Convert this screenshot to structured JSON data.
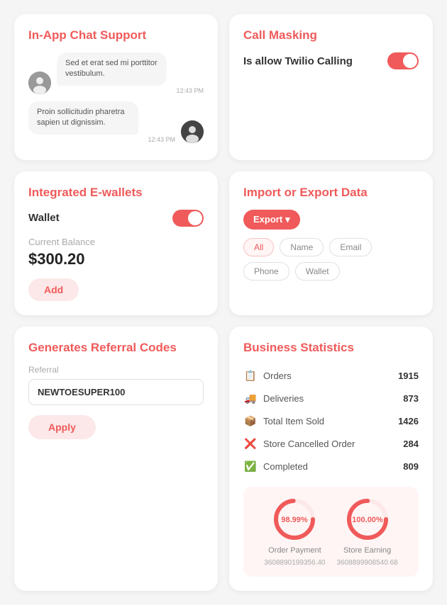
{
  "chat": {
    "title": "In-App Chat Support",
    "messages": [
      {
        "side": "left",
        "text": "Sed et erat sed mi porttitor vestibulum.",
        "time": "12:43 PM"
      },
      {
        "side": "right",
        "text": "Proin sollicitudin pharetra sapien ut dignissim.",
        "time": "12:43 PM"
      }
    ]
  },
  "call_masking": {
    "title": "Call Masking",
    "label": "Is allow Twilio Calling",
    "enabled": true
  },
  "import_export": {
    "title": "Import or Export Data",
    "export_label": "Export",
    "filters": [
      "All",
      "Name",
      "Email",
      "Phone",
      "Wallet"
    ],
    "active_filter": "All"
  },
  "ewallets": {
    "title": "Integrated E-wallets",
    "wallet_label": "Wallet",
    "wallet_enabled": true,
    "balance_label": "Current Balance",
    "balance": "$300.20",
    "add_label": "Add"
  },
  "referral": {
    "title": "Generates Referral Codes",
    "input_label": "Referral",
    "input_value": "NEWTOESUPER100",
    "apply_label": "Apply"
  },
  "business_stats": {
    "title": "Business Statistics",
    "stats": [
      {
        "icon": "📋",
        "label": "Orders",
        "value": "1915"
      },
      {
        "icon": "🚚",
        "label": "Deliveries",
        "value": "873"
      },
      {
        "icon": "📦",
        "label": "Total Item Sold",
        "value": "1426"
      },
      {
        "icon": "❌",
        "label": "Store Cancelled Order",
        "value": "284"
      },
      {
        "icon": "✅",
        "label": "Completed",
        "value": "809"
      }
    ],
    "charts": [
      {
        "percent": 98.99,
        "label": "Order Payment",
        "value": "3608890199356.40",
        "display": "98.99%",
        "stroke_color": "#f05a5a",
        "track_color": "#fce8e8"
      },
      {
        "percent": 100,
        "label": "Store Earning",
        "value": "3608899908540.68",
        "display": "100.00%",
        "stroke_color": "#f05a5a",
        "track_color": "#fce8e8"
      }
    ]
  },
  "icons": {
    "orders": "📋",
    "deliveries": "🚚",
    "items_sold": "📦",
    "cancelled": "❌",
    "completed": "✅",
    "dropdown": "▾"
  }
}
